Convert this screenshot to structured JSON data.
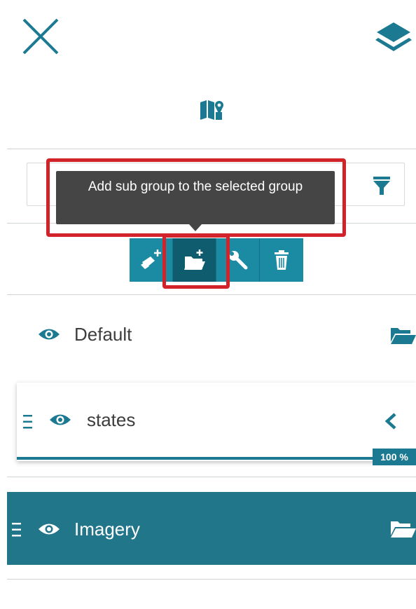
{
  "header": {
    "close_icon": "close-icon",
    "layers_icon": "layers-icon",
    "map_icon": "map-icon"
  },
  "filter": {
    "search_placeholder": "",
    "filter_icon": "filter-icon"
  },
  "tooltip": {
    "text": "Add sub group to the selected group"
  },
  "toolbar": {
    "buttons": [
      {
        "icon": "add-layer-icon",
        "active": false
      },
      {
        "icon": "add-subgroup-folder-icon",
        "active": true
      },
      {
        "icon": "wrench-icon",
        "active": false
      },
      {
        "icon": "trash-icon",
        "active": false
      }
    ]
  },
  "layers": {
    "items": [
      {
        "label": "Default",
        "visible": true,
        "type": "group"
      },
      {
        "label": "states",
        "visible": true,
        "type": "layer",
        "opacity": "100 %"
      },
      {
        "label": "Imagery",
        "visible": true,
        "type": "group",
        "selected": true
      }
    ]
  },
  "colors": {
    "accent": "#1b7a91",
    "toolbar": "#1b8aa3",
    "selected_row": "#22768a",
    "highlight": "#d2232a",
    "tooltip_bg": "#454545"
  }
}
